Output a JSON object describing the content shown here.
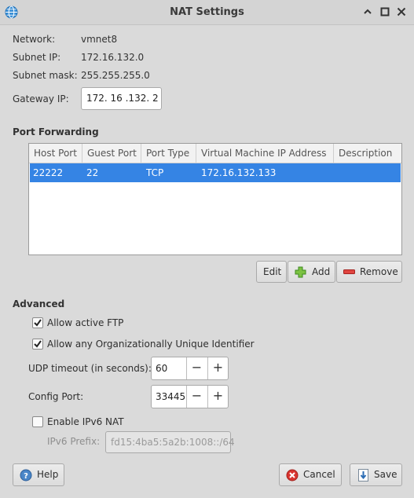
{
  "window": {
    "title": "NAT Settings",
    "controls": [
      "minimize-icon",
      "maximize-icon",
      "close-icon"
    ]
  },
  "info": {
    "network_label": "Network:",
    "network_value": "vmnet8",
    "subnet_ip_label": "Subnet IP:",
    "subnet_ip_value": "172.16.132.0",
    "subnet_mask_label": "Subnet mask:",
    "subnet_mask_value": "255.255.255.0",
    "gateway_label": "Gateway IP:",
    "gateway_value": "172. 16 .132.  2"
  },
  "port_forwarding": {
    "heading": "Port Forwarding",
    "columns": [
      "Host Port",
      "Guest Port",
      "Port Type",
      "Virtual Machine IP Address",
      "Description"
    ],
    "rows": [
      {
        "host_port": "22222",
        "guest_port": "22",
        "port_type": "TCP",
        "vm_ip": "172.16.132.133",
        "description": ""
      }
    ],
    "buttons": {
      "edit": "Edit",
      "add": "Add",
      "remove": "Remove"
    }
  },
  "advanced": {
    "heading": "Advanced",
    "allow_ftp_label": "Allow active FTP",
    "allow_ftp_checked": true,
    "allow_oui_label": "Allow any Organizationally Unique Identifier",
    "allow_oui_checked": true,
    "udp_timeout_label": "UDP timeout (in seconds):",
    "udp_timeout_value": "60",
    "config_port_label": "Config Port:",
    "config_port_value": "33445",
    "ipv6_label": "Enable IPv6 NAT",
    "ipv6_checked": false,
    "ipv6_prefix_label": "IPv6 Prefix:",
    "ipv6_prefix_value": "fd15:4ba5:5a2b:1008::/64",
    "spin_minus": "−",
    "spin_plus": "+"
  },
  "footer": {
    "help": "Help",
    "cancel": "Cancel",
    "save": "Save"
  },
  "colors": {
    "selection": "#3584e4",
    "add_icon": "#5ab030",
    "remove_icon": "#d0312d",
    "help_icon": "#4a86c8"
  }
}
